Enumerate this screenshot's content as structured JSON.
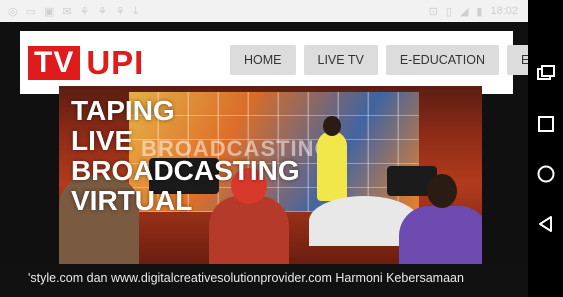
{
  "status_bar": {
    "time": "18:02",
    "left_icons": [
      "whatsapp-icon",
      "message-icon",
      "image-icon",
      "mail-icon",
      "app-icon",
      "app-icon",
      "app-icon",
      "download-icon"
    ],
    "right_icons": [
      "cast-icon",
      "vibrate-icon",
      "signal-icon",
      "battery-icon"
    ]
  },
  "header": {
    "logo_tv": "TV",
    "logo_upi": "UPI",
    "menu": [
      "HOME",
      "LIVE TV",
      "E-EDUCATION",
      "E-EX"
    ]
  },
  "hero": {
    "title_lines": [
      "TAPING",
      "LIVE",
      "BROADCASTING",
      "VIRTUAL"
    ],
    "background_text": "BROADCASTING"
  },
  "ticker": {
    "text": "'style.com dan www.digitalcreativesolutionprovider.com   Harmoni Kebersamaan"
  },
  "navbar": {
    "buttons": [
      "recent-switch-icon",
      "overview-square-icon",
      "home-circle-icon",
      "back-triangle-icon"
    ]
  },
  "colors": {
    "brand_red": "#e01b1b",
    "menu_bg": "#dcdcdc",
    "nav_bg": "#000000"
  }
}
